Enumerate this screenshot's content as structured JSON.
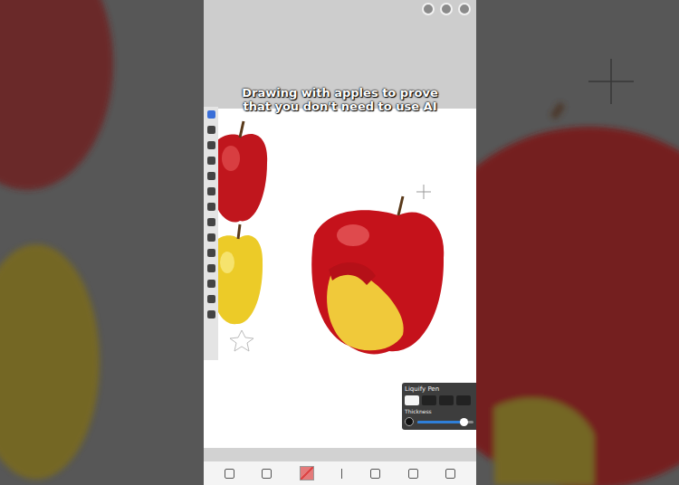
{
  "caption": "Drawing with apples to prove that you don't need to use AI",
  "toolbar": {
    "tools": [
      {
        "selected": true
      },
      {
        "selected": false
      },
      {
        "selected": false
      },
      {
        "selected": false
      },
      {
        "selected": false
      },
      {
        "selected": false
      },
      {
        "selected": false
      },
      {
        "selected": false
      },
      {
        "selected": false
      },
      {
        "selected": false
      },
      {
        "selected": false
      },
      {
        "selected": false
      },
      {
        "selected": false
      },
      {
        "selected": false
      }
    ]
  },
  "liquify": {
    "title": "Liquify Pen",
    "modes": [
      {
        "selected": true
      },
      {
        "selected": false
      },
      {
        "selected": false
      },
      {
        "selected": false
      }
    ],
    "thickness": {
      "label": "Thickness",
      "level": 0.82
    }
  }
}
